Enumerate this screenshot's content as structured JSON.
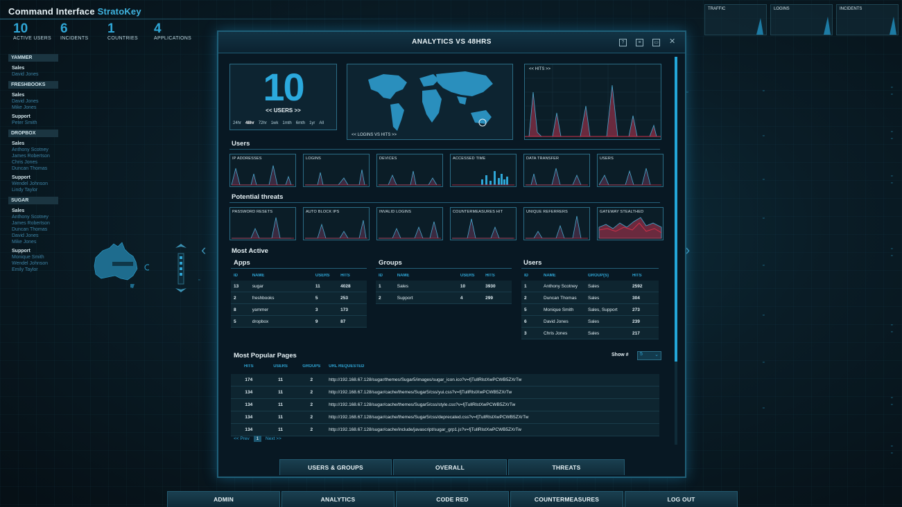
{
  "app": {
    "title": "Command Interface",
    "brand": "StratoKey"
  },
  "stats": [
    {
      "num": "10",
      "label": "ACTIVE USERS"
    },
    {
      "num": "6",
      "label": "INCIDENTS"
    },
    {
      "num": "1",
      "label": "COUNTRIES"
    },
    {
      "num": "4",
      "label": "APPLICATIONS"
    }
  ],
  "sidebar": {
    "groups": [
      {
        "name": "YAMMER",
        "sections": [
          {
            "name": "Sales",
            "users": [
              "David Jones"
            ]
          }
        ]
      },
      {
        "name": "FRESHBOOKS",
        "sections": [
          {
            "name": "Sales",
            "users": [
              "David Jones",
              "Mike Jones"
            ]
          },
          {
            "name": "Support",
            "users": [
              "Peter Smith"
            ]
          }
        ]
      },
      {
        "name": "DROPBOX",
        "sections": [
          {
            "name": "Sales",
            "users": [
              "Anthony Scotney",
              "James Robertson",
              "Chris Jones",
              "Duncan Thomas"
            ]
          },
          {
            "name": "Support",
            "users": [
              "Wendel Johnson",
              "Lindy Taylor"
            ]
          }
        ]
      },
      {
        "name": "SUGAR",
        "sections": [
          {
            "name": "Sales",
            "users": [
              "Anthony Scotney",
              "James Robertson",
              "Duncan Thomas",
              "David Jones",
              "Mike Jones"
            ]
          },
          {
            "name": "Support",
            "users": [
              "Monique Smith",
              "Wendel Johnson",
              "Emily Taylor"
            ]
          }
        ]
      }
    ]
  },
  "mini_charts": [
    "TRAFFIC",
    "LOGINS",
    "INCIDENTS"
  ],
  "modal": {
    "title": "ANALYTICS VS 48HRS",
    "users_count": "10",
    "users_label": "<< USERS >>",
    "ranges": [
      "24hr",
      "48hr",
      "72hr",
      "1wk",
      "1mth",
      "6mth",
      "1yr",
      "All"
    ],
    "selected_range": "48hr",
    "map_label": "<< LOGINS VS HITS >>",
    "hits_label": "<< HITS >>",
    "users_section": "Users",
    "users_charts": [
      "IP ADDRESSES",
      "LOGINS",
      "DEVICES",
      "ACCESSED TIME",
      "DATA TRANSFER",
      "USERS"
    ],
    "threats_section": "Potential threats",
    "threats_charts": [
      "PASSWORD RESETS",
      "AUTO BLOCK IPS",
      "INVALID LOGINS",
      "COUNTERMEASURES HIT",
      "UNIQUE REFERRERS",
      "GATEWAY STEALTHED"
    ],
    "most_active": "Most Active",
    "apps": {
      "title": "Apps",
      "headers": [
        "ID",
        "NAME",
        "USERS",
        "HITS"
      ],
      "rows": [
        [
          "13",
          "sugar",
          "11",
          "4028"
        ],
        [
          "2",
          "freshbooks",
          "5",
          "253"
        ],
        [
          "8",
          "yammer",
          "3",
          "173"
        ],
        [
          "5",
          "dropbox",
          "9",
          "87"
        ]
      ]
    },
    "groups": {
      "title": "Groups",
      "headers": [
        "ID",
        "NAME",
        "USERS",
        "HITS"
      ],
      "rows": [
        [
          "1",
          "Sales",
          "10",
          "3930"
        ],
        [
          "2",
          "Support",
          "4",
          "299"
        ]
      ]
    },
    "users": {
      "title": "Users",
      "headers": [
        "ID",
        "NAME",
        "GROUP(S)",
        "HITS"
      ],
      "rows": [
        [
          "1",
          "Anthony Scotney",
          "Sales",
          "2592"
        ],
        [
          "2",
          "Duncan Thomas",
          "Sales",
          "304"
        ],
        [
          "5",
          "Monique Smith",
          "Sales, Support",
          "273"
        ],
        [
          "6",
          "David Jones",
          "Sales",
          "239"
        ],
        [
          "3",
          "Chris Jones",
          "Sales",
          "217"
        ]
      ]
    },
    "popular": {
      "title": "Most Popular Pages",
      "show_label": "Show #",
      "show_value": "5",
      "headers": [
        "HITS",
        "USERS",
        "GROUPS",
        "URL REQUESTED"
      ],
      "rows": [
        [
          "174",
          "11",
          "2",
          "http://192.168.67.128/sugar/themes/Sugar5/images/sugar_icon.ico?v=fjTullRlstXwPCWB5ZXrTw"
        ],
        [
          "134",
          "11",
          "2",
          "http://192.168.67.128/sugar/cache/themes/Sugar5/css/yui.css?v=fjTullRlstXwPCWB5ZXrTw"
        ],
        [
          "134",
          "11",
          "2",
          "http://192.168.67.128/sugar/cache/themes/Sugar5/css/style.css?v=fjTullRlstXwPCWB5ZXrTw"
        ],
        [
          "134",
          "11",
          "2",
          "http://192.168.67.128/sugar/cache/themes/Sugar5/css/deprecated.css?v=fjTullRlstXwPCWB5ZXrTw"
        ],
        [
          "134",
          "11",
          "2",
          "http://192.168.67.128/sugar/cache/include/javascript/sugar_grp1.js?v=fjTullRlstXwPCWB5ZXrTw"
        ]
      ],
      "prev": "<< Prev",
      "page": "1",
      "next": "Next >>"
    },
    "tabs": [
      "USERS & GROUPS",
      "OVERALL",
      "THREATS"
    ]
  },
  "bottom_nav": [
    "ADMIN",
    "ANALYTICS",
    "CODE RED",
    "COUNTERMEASURES",
    "LOG OUT"
  ],
  "colors": {
    "accent": "#2fa6d6",
    "panel": "#0d2431",
    "border": "#2c6d86",
    "alert": "#d1304a"
  }
}
